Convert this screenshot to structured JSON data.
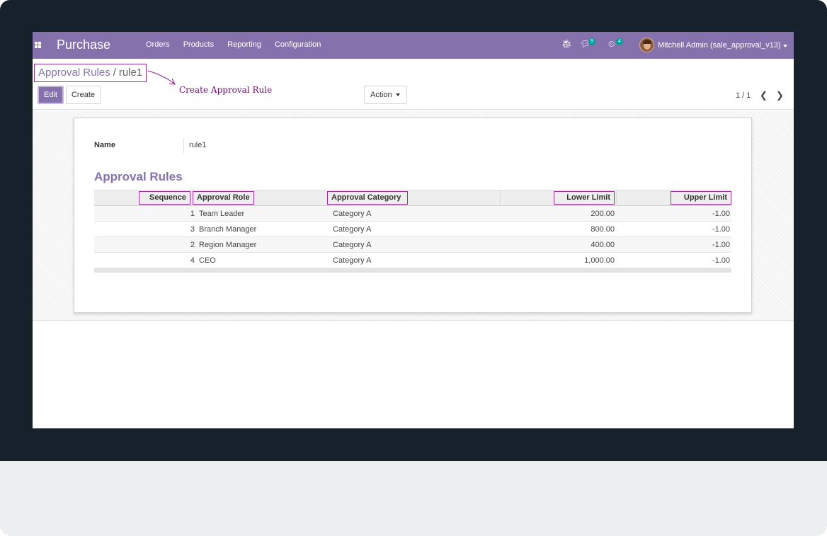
{
  "navbar": {
    "app_name": "Purchase",
    "menu": [
      "Orders",
      "Products",
      "Reporting",
      "Configuration"
    ],
    "chat_count": "9",
    "activity_count": "4",
    "user": "Mitchell Admin (sale_approval_v13)"
  },
  "breadcrumb": {
    "parent": "Approval Rules",
    "separator": "/",
    "current": "rule1"
  },
  "annotation": "Create Approval Rule",
  "buttons": {
    "edit": "Edit",
    "create": "Create",
    "action": "Action"
  },
  "pager": "1 / 1",
  "form": {
    "name_label": "Name",
    "name_value": "rule1",
    "section_title": "Approval Rules",
    "columns": [
      "Sequence",
      "Approval Role",
      "Approval Category",
      "Lower Limit",
      "Upper Limit"
    ],
    "rows": [
      {
        "sequence": "1",
        "role": "Team Leader",
        "category": "Category A",
        "lower": "200.00",
        "upper": "-1.00"
      },
      {
        "sequence": "3",
        "role": "Branch Manager",
        "category": "Category A",
        "lower": "800.00",
        "upper": "-1.00"
      },
      {
        "sequence": "2",
        "role": "Region Manager",
        "category": "Category A",
        "lower": "400.00",
        "upper": "-1.00"
      },
      {
        "sequence": "4",
        "role": "CEO",
        "category": "Category A",
        "lower": "1,000.00",
        "upper": "-1.00"
      }
    ]
  },
  "colors": {
    "brand": "#8572ad",
    "highlight": "#9c2f9c",
    "bezel": "#17212b"
  }
}
